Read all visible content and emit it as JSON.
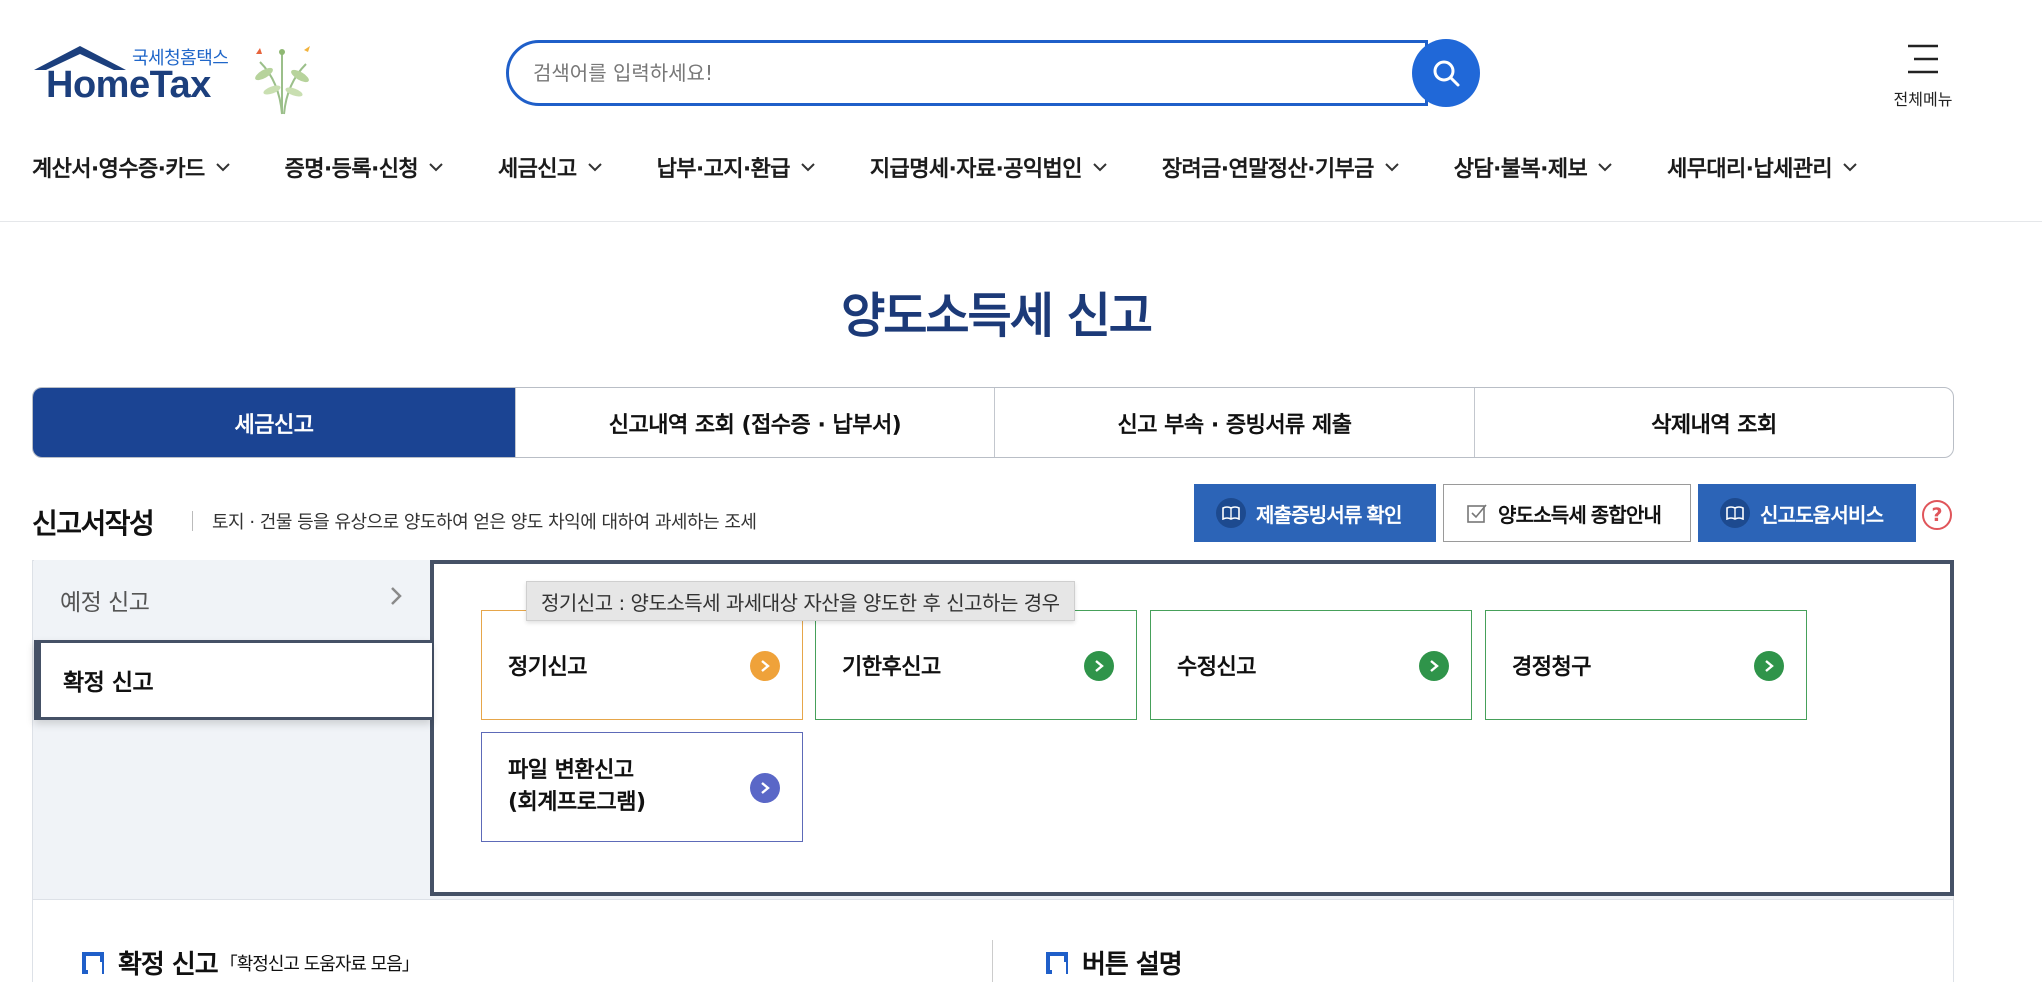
{
  "header": {
    "logo_sub": "국세청홈택스",
    "logo_main": "HomeTax",
    "search_placeholder": "검색어를 입력하세요!",
    "all_menu_label": "전체메뉴"
  },
  "gnb": [
    "계산서·영수증·카드",
    "증명·등록·신청",
    "세금신고",
    "납부·고지·환급",
    "지급명세·자료·공익법인",
    "장려금·연말정산·기부금",
    "상담·불복·제보",
    "세무대리·납세관리"
  ],
  "page_title": "양도소득세 신고",
  "tabs": [
    {
      "label": "세금신고",
      "active": true
    },
    {
      "label": "신고내역 조회 (접수증 · 납부서)",
      "active": false
    },
    {
      "label": "신고 부속 · 증빙서류 제출",
      "active": false
    },
    {
      "label": "삭제내역 조회",
      "active": false
    }
  ],
  "section": {
    "title": "신고서작성",
    "desc": "토지 · 건물 등을 유상으로 양도하여 얻은 양도 차익에 대하여 과세하는 조세",
    "btn_proof": "제출증빙서류 확인",
    "btn_guide": "양도소득세 종합안내",
    "btn_help_service": "신고도움서비스",
    "help_mark": "?"
  },
  "left_menu": {
    "item1": "예정 신고",
    "item2": "확정 신고"
  },
  "tooltip": "정기신고 : 양도소득세 과세대상 자산을 양도한 후 신고하는 경우",
  "cards": {
    "c1": "정기신고",
    "c2": "기한후신고",
    "c3": "수정신고",
    "c4": "경정청구",
    "c5_line1": "파일 변환신고",
    "c5_line2": "(회계프로그램)"
  },
  "bottom": {
    "left_title": "확정 신고",
    "left_sub": "「확정신고 도움자료 모음」",
    "right_title": "버튼 설명"
  },
  "colors": {
    "brand_navy": "#1b4493",
    "button_blue": "#2c64b7",
    "search_blue": "#2068d8",
    "card_orange": "#efa23a",
    "card_green": "#2f944a",
    "card_purple": "#5a67c7",
    "help_red": "#e0555a"
  }
}
